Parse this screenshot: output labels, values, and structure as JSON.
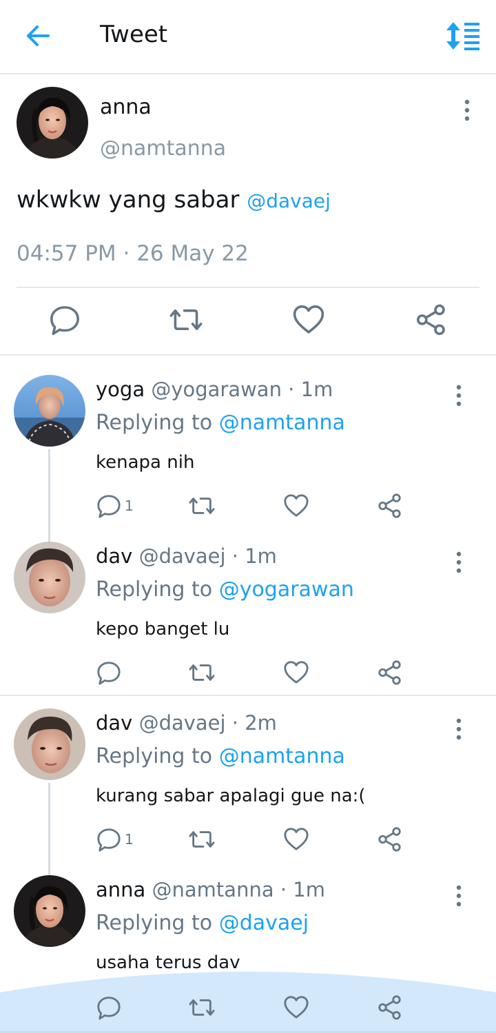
{
  "header": {
    "title": "Tweet",
    "back_icon": "arrow-left-icon",
    "sort_icon": "sort-list-icon",
    "accent_color": "#1da1f2"
  },
  "main_tweet": {
    "name": "anna",
    "handle": "@namtanna",
    "text": "wkwkw yang sabar",
    "mention": "@davaej",
    "timestamp": "04:57 PM · 26 May 22"
  },
  "replies": [
    {
      "name": "yoga",
      "handle": "@yogarawan · 1m",
      "replying_label": "Replying to",
      "replying_to": "@namtanna",
      "text": "kenapa nih",
      "reply_count": "1"
    },
    {
      "name": "dav",
      "handle": "@davaej · 1m",
      "replying_label": "Replying to",
      "replying_to": "@yogarawan",
      "text": "kepo banget lu",
      "reply_count": ""
    },
    {
      "name": "dav",
      "handle": "@davaej · 2m",
      "replying_label": "Replying to",
      "replying_to": "@namtanna",
      "text": "kurang sabar apalagi gue na:(",
      "reply_count": "1"
    },
    {
      "name": "anna",
      "handle": "@namtanna · 1m",
      "replying_label": "Replying to",
      "replying_to": "@davaej",
      "text": "usaha terus dav",
      "reply_count": ""
    }
  ]
}
